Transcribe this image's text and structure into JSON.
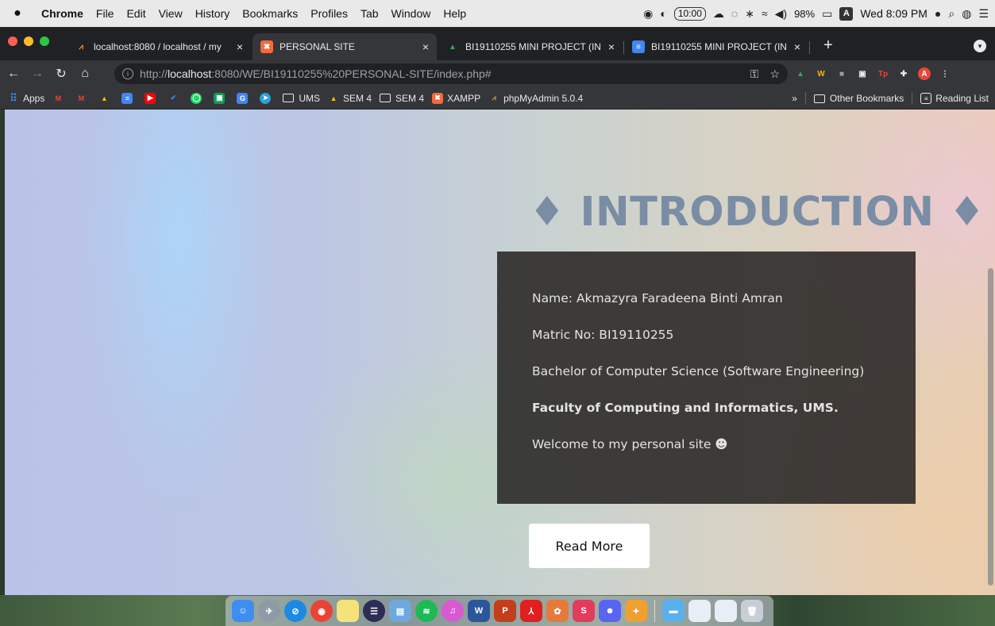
{
  "menubar": {
    "apple": "",
    "items": [
      "Chrome",
      "File",
      "Edit",
      "View",
      "History",
      "Bookmarks",
      "Profiles",
      "Tab",
      "Window",
      "Help"
    ],
    "clock_badge": "10:00",
    "battery": "98%",
    "input_source": "A",
    "datetime": "Wed 8:09 PM"
  },
  "tabs": [
    {
      "title": "localhost:8080 / localhost / my",
      "icon": "phpmyadmin-icon",
      "active": false
    },
    {
      "title": "PERSONAL SITE",
      "icon": "xampp-icon",
      "active": true
    },
    {
      "title": "BI19110255 MINI PROJECT (IN",
      "icon": "drive-icon",
      "active": false
    },
    {
      "title": "BI19110255 MINI PROJECT (IN",
      "icon": "docs-icon",
      "active": false
    }
  ],
  "tab_close": "×",
  "new_tab": "+",
  "toolbar": {
    "url_prefix": "http://",
    "url_host": "localhost",
    "url_rest": ":8080/WE/BI19110255%20PERSONAL-SITE/index.php#"
  },
  "bookmarks": {
    "apps": "Apps",
    "items": [
      {
        "label": "UMS",
        "type": "folder"
      },
      {
        "label": "SEM 4",
        "type": "drive"
      },
      {
        "label": "SEM 4",
        "type": "folder"
      },
      {
        "label": "XAMPP",
        "type": "xampp"
      },
      {
        "label": "phpMyAdmin 5.0.4",
        "type": "phpmyadmin"
      }
    ],
    "more": "»",
    "other": "Other Bookmarks",
    "reading": "Reading List"
  },
  "page": {
    "heading": "♦ INTRODUCTION ♦",
    "lines": [
      "Name: Akmazyra Faradeena Binti Amran",
      "Matric No: BI19110255",
      "Bachelor of Computer Science (Software Engineering)",
      "Faculty of Computing and Informatics, UMS.",
      "Welcome to my personal site ☻"
    ],
    "read_more": "Read More"
  },
  "colors": {
    "heading": "#7a8da4",
    "box_bg": "#282624",
    "chrome_dark": "#202124"
  }
}
